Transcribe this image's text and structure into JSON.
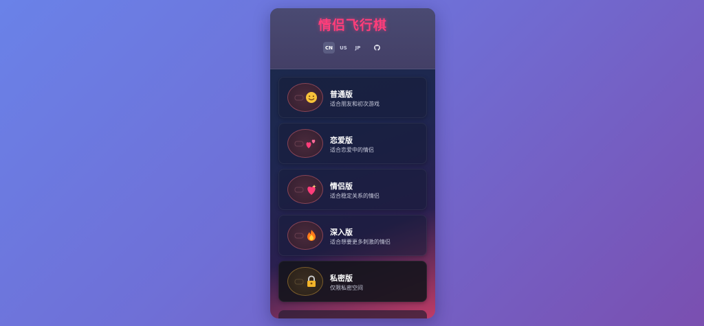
{
  "app": {
    "title": "情侣飞行棋"
  },
  "languages": [
    {
      "code": "CN",
      "active": true
    },
    {
      "code": "US",
      "active": false
    },
    {
      "code": "JP",
      "active": false
    }
  ],
  "github_icon": "github-icon",
  "modes": [
    {
      "title": "普通版",
      "desc": "适合朋友和初次游戏",
      "icon": "smiling-face-icon"
    },
    {
      "title": "恋爱版",
      "desc": "适合恋爱中的情侣",
      "icon": "two-hearts-icon"
    },
    {
      "title": "情侣版",
      "desc": "适合稳定关系的情侣",
      "icon": "sparkling-heart-icon"
    },
    {
      "title": "深入版",
      "desc": "适合想要更多刺激的情侣",
      "icon": "fire-icon"
    },
    {
      "title": "私密版",
      "desc": "仅限私密空间",
      "icon": "lock-icon"
    }
  ],
  "colors": {
    "title": "#ff3d7a",
    "accent_border": "#e66e82",
    "locked_border": "#c8963c"
  }
}
